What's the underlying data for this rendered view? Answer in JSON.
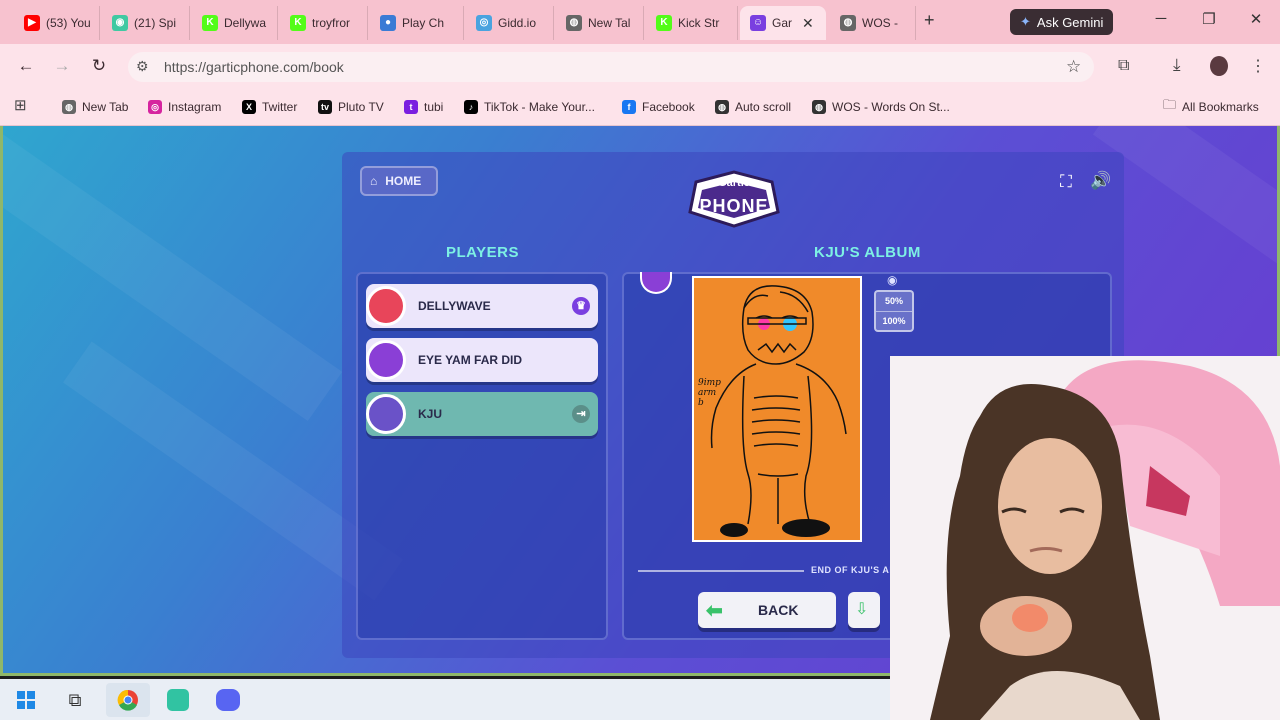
{
  "browser": {
    "tabs": [
      {
        "label": "(53) You",
        "color": "#ff0000",
        "glyph": "▶"
      },
      {
        "label": "(21) Spi",
        "color": "#40c9a2",
        "glyph": "◉"
      },
      {
        "label": "Dellywa",
        "color": "#53fc18",
        "glyph": "K"
      },
      {
        "label": "troyfror",
        "color": "#53fc18",
        "glyph": "K"
      },
      {
        "label": "Play Ch",
        "color": "#3a7bd5",
        "glyph": "●"
      },
      {
        "label": "Gidd.io",
        "color": "#4aa3df",
        "glyph": "◎"
      },
      {
        "label": "New Tal",
        "color": "#666666",
        "glyph": "◍"
      },
      {
        "label": "Kick Str",
        "color": "#53fc18",
        "glyph": "K"
      },
      {
        "label": "Gar",
        "color": "#7a3fe0",
        "glyph": "☺"
      },
      {
        "label": "WOS -",
        "color": "#666666",
        "glyph": "◍"
      }
    ],
    "new_tab_glyph": "+",
    "gemini_label": "Ask Gemini",
    "url": "https://garticphone.com/book",
    "bookmarks": [
      {
        "label": "New Tab",
        "color": "#666666",
        "glyph": "◍"
      },
      {
        "label": "Instagram",
        "color": "#d6249f",
        "glyph": "◎"
      },
      {
        "label": "Twitter",
        "color": "#000000",
        "glyph": "X"
      },
      {
        "label": "Pluto TV",
        "color": "#111111",
        "glyph": "tv"
      },
      {
        "label": "tubi",
        "color": "#7b1fe0",
        "glyph": "t"
      },
      {
        "label": "TikTok - Make Your...",
        "color": "#000000",
        "glyph": "♪"
      },
      {
        "label": "Facebook",
        "color": "#1877f2",
        "glyph": "f"
      },
      {
        "label": "Auto scroll",
        "color": "#333333",
        "glyph": "◍"
      },
      {
        "label": "WOS - Words On St...",
        "color": "#333333",
        "glyph": "◍"
      }
    ],
    "all_bookmarks_label": "All Bookmarks"
  },
  "game": {
    "home_label": "HOME",
    "logo_top": "Gartic",
    "logo_bottom": "PHONE",
    "players_title": "PLAYERS",
    "album_title": "KJU'S ALBUM",
    "players": [
      {
        "name": "DELLYWAVE",
        "avatar_color": "#e8455a",
        "icon": "♛"
      },
      {
        "name": "EYE YAM FAR DID",
        "avatar_color": "#8a3fd6",
        "icon": ""
      },
      {
        "name": "KJU",
        "avatar_color": "#6a52c8",
        "icon": "⇥"
      }
    ],
    "drawing_text": "9imp\narm\nb",
    "zoom_options": [
      "50%",
      "100%"
    ],
    "end_label": "END OF KJU'S ALBUM",
    "back_label": "BACK",
    "accent_color": "#7df0e4"
  }
}
